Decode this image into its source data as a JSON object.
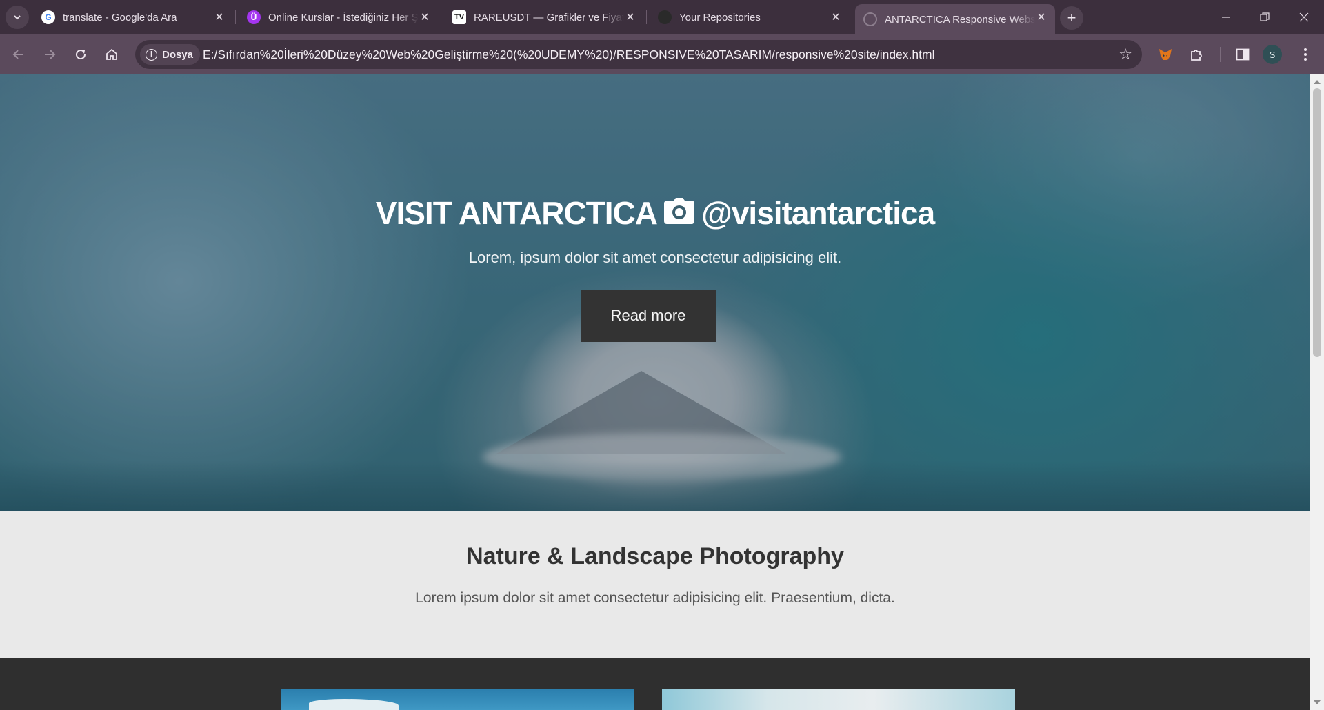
{
  "browser": {
    "tabs": [
      {
        "title": "translate - Google'da Ara",
        "icon": "google-icon"
      },
      {
        "title": "Online Kurslar - İstediğiniz Her Şeyi Öğrenin",
        "icon": "udemy-icon"
      },
      {
        "title": "RAREUSDT — Grafikler ve Fiyatlar",
        "icon": "tradingview-icon"
      },
      {
        "title": "Your Repositories",
        "icon": "github-icon"
      },
      {
        "title": "ANTARCTICA Responsive Website",
        "icon": "globe-icon"
      }
    ],
    "active_tab_index": 4,
    "address": {
      "chip_label": "Dosya",
      "url": "E:/Sıfırdan%20İleri%20Düzey%20Web%20Geliştirme%20(%20UDEMY%20)/RESPONSIVE%20TASARIM/responsive%20site/index.html"
    },
    "profile_initial": "S"
  },
  "hero": {
    "title_left": "VISIT ANTARCTICA",
    "title_right": "@visitantarctica",
    "subtitle": "Lorem, ipsum dolor sit amet consectetur adipisicing elit.",
    "button_label": "Read more"
  },
  "intro": {
    "title": "Nature & Landscape Photography",
    "text": "Lorem ipsum dolor sit amet consectetur adipisicing elit. Praesentium, dicta."
  },
  "colors": {
    "tabstrip": "#3c2f3d",
    "toolbar": "#5b4a5c",
    "button_bg": "#333333",
    "intro_bg": "#e9e9e9",
    "gallery_bg": "#2f2f2f"
  }
}
